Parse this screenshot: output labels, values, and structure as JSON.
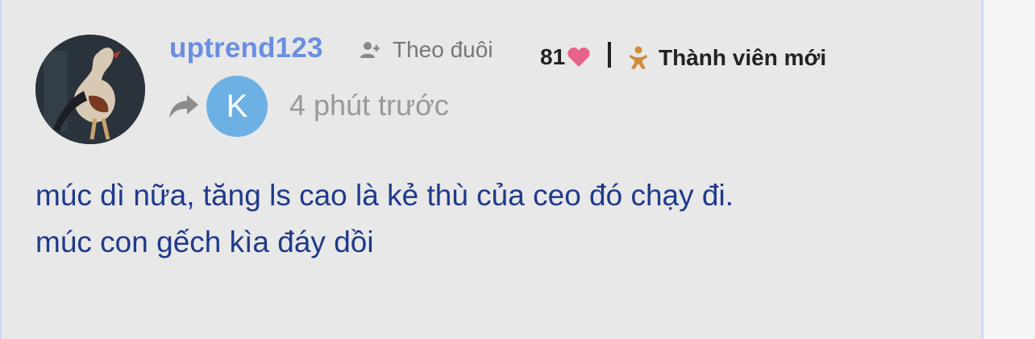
{
  "post": {
    "username": "uptrend123",
    "follow_label": "Theo đuôi",
    "likes_count": "81",
    "rank_label": "Thành viên mới",
    "reply_avatar_letter": "K",
    "timestamp": "4 phút trước",
    "comment_lines": [
      "múc dì nữa, tăng ls cao là kẻ thù của ceo đó chạy đi.",
      "múc con gếch kìa đáy dồi"
    ]
  },
  "icons": {
    "follow": "user-plus-icon",
    "likes": "heart-icon",
    "rank": "baby-icon",
    "share": "share-arrow-icon"
  },
  "colors": {
    "username": "#6a8fe0",
    "heart": "#e8638a",
    "rank_icon": "#d08a3a",
    "reply_avatar": "#6cb0e4",
    "comment_text": "#1f3a8a"
  }
}
